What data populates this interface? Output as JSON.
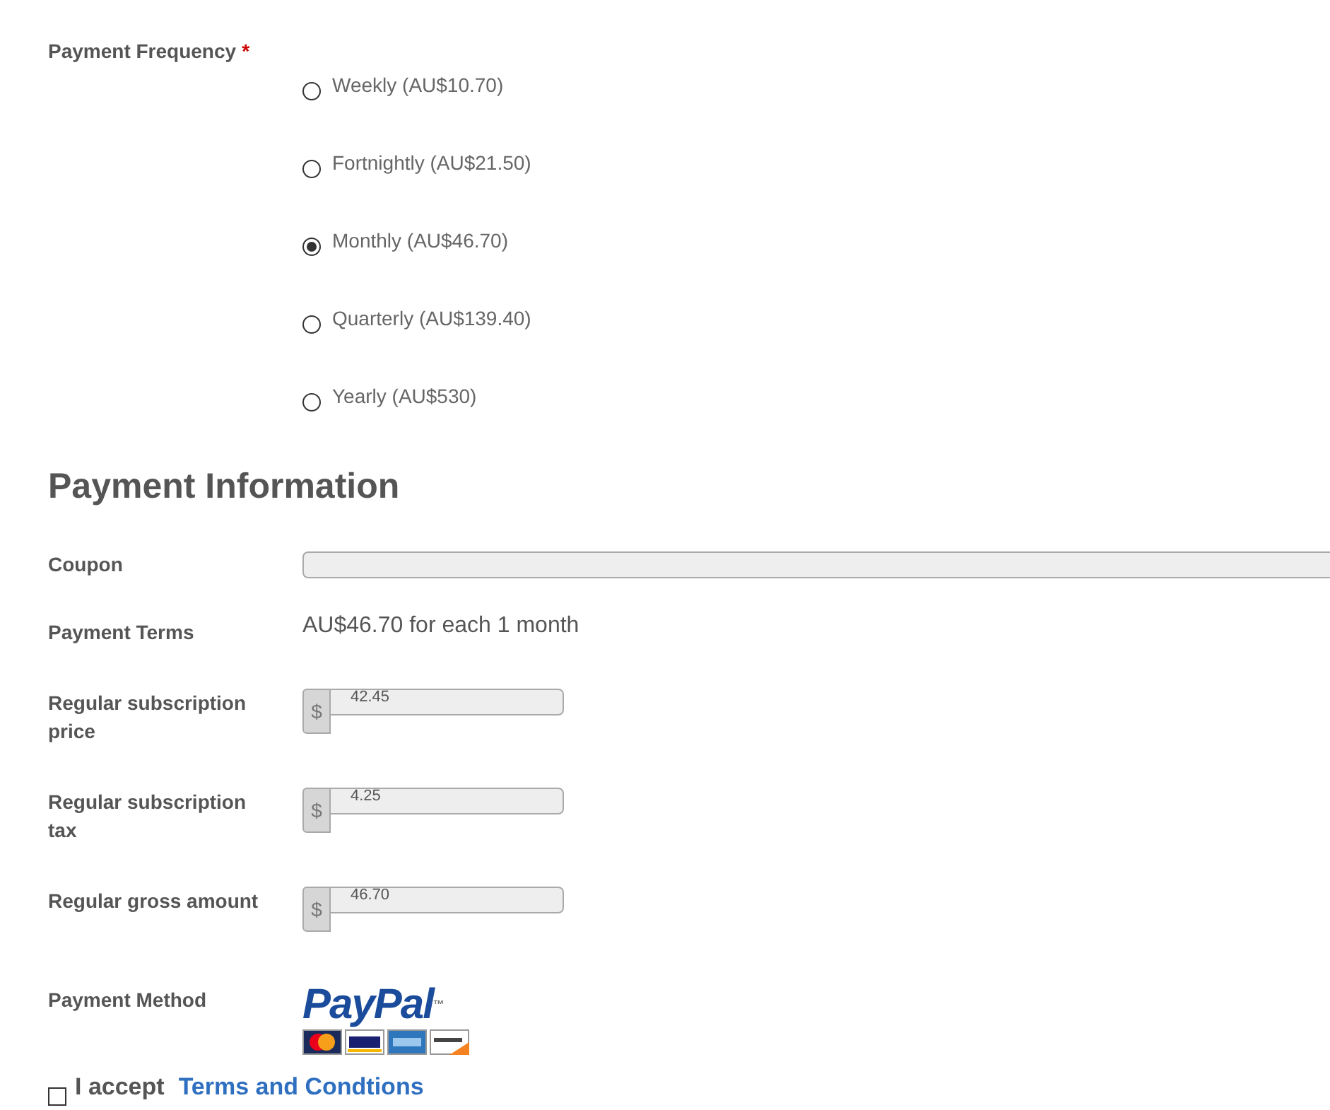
{
  "frequency": {
    "label": "Payment Frequency",
    "required_mark": "*",
    "options": [
      {
        "label": "Weekly (AU$10.70)",
        "selected": false
      },
      {
        "label": "Fortnightly (AU$21.50)",
        "selected": false
      },
      {
        "label": "Monthly (AU$46.70)",
        "selected": true
      },
      {
        "label": "Quarterly (AU$139.40)",
        "selected": false
      },
      {
        "label": "Yearly (AU$530)",
        "selected": false
      }
    ]
  },
  "payment_information": {
    "heading": "Payment Information",
    "coupon": {
      "label": "Coupon"
    },
    "terms": {
      "label": "Payment Terms",
      "value": "AU$46.70 for each 1 month"
    },
    "amounts": [
      {
        "label": "Regular subscription price",
        "prefix": "$",
        "value": "42.45"
      },
      {
        "label": "Regular subscription tax",
        "prefix": "$",
        "value": "4.25"
      },
      {
        "label": "Regular gross amount",
        "prefix": "$",
        "value": "46.70"
      }
    ],
    "method": {
      "label": "Payment Method",
      "logo": "PayPal",
      "logo_mark": "™"
    }
  },
  "accept": {
    "checked": false,
    "text": "I accept",
    "link": "Terms and Condtions"
  }
}
